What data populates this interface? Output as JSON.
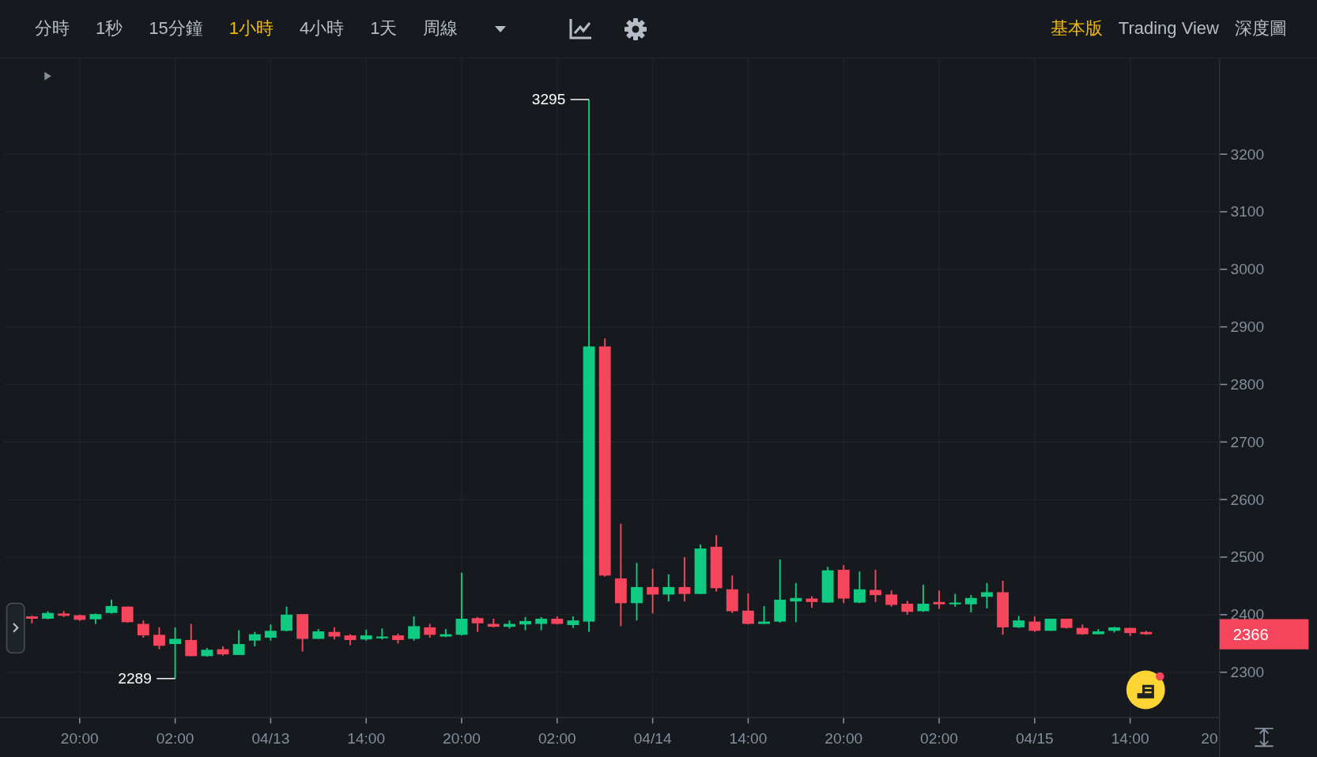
{
  "toolbar": {
    "intervals": [
      {
        "label": "分時",
        "selected": false
      },
      {
        "label": "1秒",
        "selected": false
      },
      {
        "label": "15分鐘",
        "selected": false
      },
      {
        "label": "1小時",
        "selected": true
      },
      {
        "label": "4小時",
        "selected": false
      },
      {
        "label": "1天",
        "selected": false
      },
      {
        "label": "周線",
        "selected": false
      }
    ],
    "views": [
      {
        "label": "基本版",
        "selected": true
      },
      {
        "label": "Trading View",
        "selected": false
      },
      {
        "label": "深度圖",
        "selected": false
      }
    ]
  },
  "chart": {
    "high_label": "3295",
    "low_label": "2289",
    "last_price": "2366",
    "price_labels": [
      "3200",
      "3100",
      "3000",
      "2900",
      "2800",
      "2700",
      "2600",
      "2500",
      "2400",
      "2300"
    ],
    "time_labels": [
      "20:00",
      "02:00",
      "04/13",
      "14:00",
      "20:00",
      "02:00",
      "04/14",
      "14:00",
      "20:00",
      "02:00",
      "04/15",
      "14:00",
      "20"
    ]
  }
}
